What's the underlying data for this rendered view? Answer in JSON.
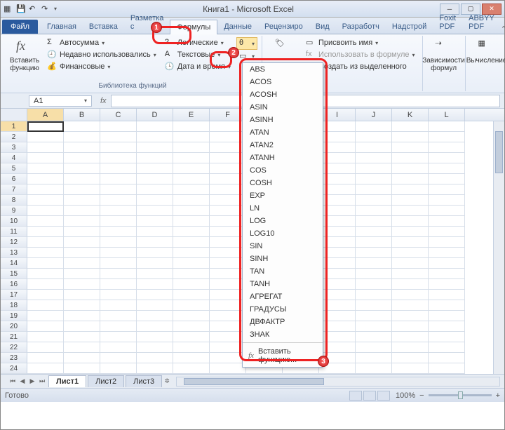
{
  "window": {
    "title": "Книга1 - Microsoft Excel"
  },
  "qat": {
    "save": "💾",
    "undo": "↶",
    "redo": "↷"
  },
  "tabs": {
    "file": "Файл",
    "items": [
      "Главная",
      "Вставка",
      "Разметка с",
      "Формулы",
      "Данные",
      "Рецензиро",
      "Вид",
      "Разработч",
      "Надстрой",
      "Foxit PDF",
      "ABBYY PDF"
    ],
    "active_index": 3
  },
  "ribbon": {
    "insert_fn_big": "Вставить функцию",
    "lib_label": "Библиотека функций",
    "autosum": "Автосумма",
    "recent": "Недавно использовались",
    "financial": "Финансовые",
    "logical": "Логические",
    "text": "Текстовые",
    "date": "Дата и время",
    "assign_name": "Присвоить имя",
    "use_in_formula": "Использовать в формуле",
    "from_selection": "Создать из выделенного",
    "deps_big": "Зависимости формул",
    "calc_big": "Вычисление"
  },
  "namebox": {
    "value": "A1"
  },
  "formulabar": {
    "fx": "fx"
  },
  "columns": [
    "A",
    "B",
    "C",
    "D",
    "E",
    "F",
    "",
    "",
    "I",
    "J",
    "K",
    "L"
  ],
  "rowcount": 24,
  "selected": {
    "row": 1,
    "col": 0
  },
  "dropdown": {
    "items": [
      "ABS",
      "ACOS",
      "ACOSH",
      "ASIN",
      "ASINH",
      "ATAN",
      "ATAN2",
      "ATANH",
      "COS",
      "COSH",
      "EXP",
      "LN",
      "LOG",
      "LOG10",
      "SIN",
      "SINH",
      "TAN",
      "TANH",
      "АГРЕГАТ",
      "ГРАДУСЫ",
      "ДВФАКТР",
      "ЗНАК"
    ],
    "insert_fn": "Вставить функцию...",
    "fxlabel": "fx"
  },
  "sheets": {
    "items": [
      "Лист1",
      "Лист2",
      "Лист3"
    ],
    "active_index": 0
  },
  "status": {
    "ready": "Готово",
    "zoom": "100%",
    "minus": "−",
    "plus": "+"
  }
}
